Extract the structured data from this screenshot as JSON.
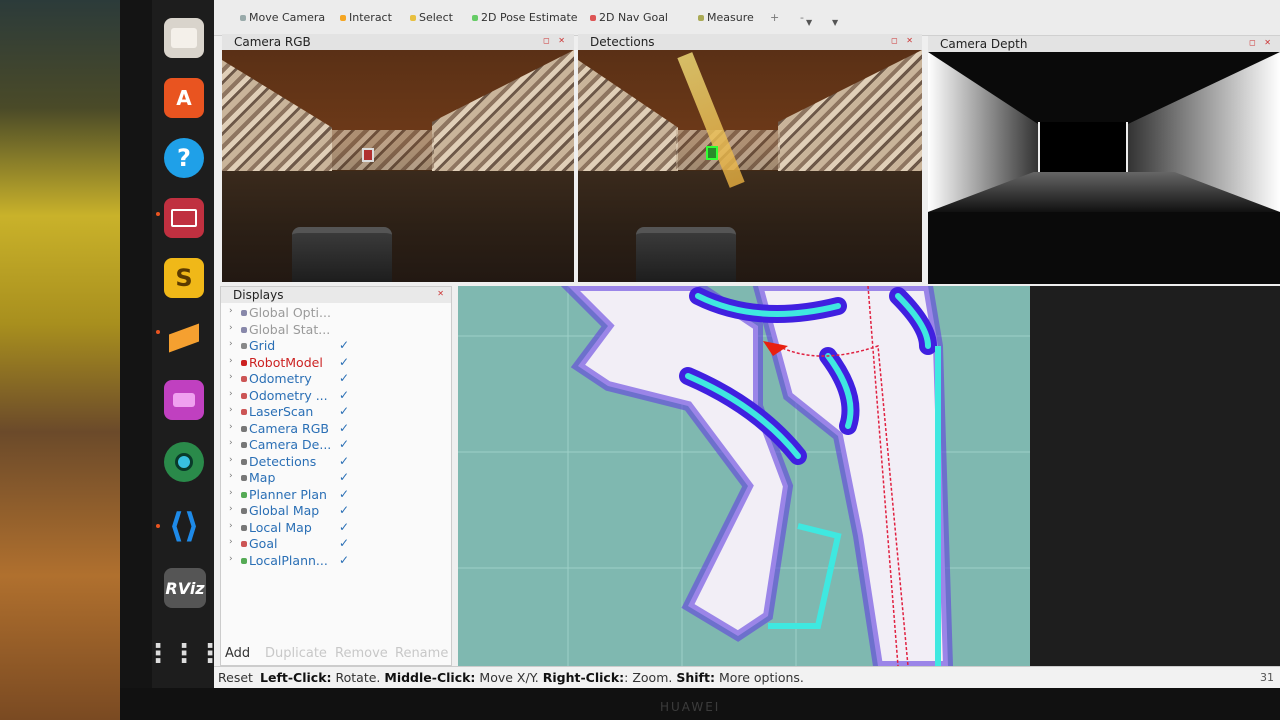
{
  "toolbar": {
    "tools": [
      {
        "label": "Move Camera",
        "color": "#9aa"
      },
      {
        "label": "Interact",
        "color": "#f5a623"
      },
      {
        "label": "Select",
        "color": "#e8c040"
      },
      {
        "label": "2D Pose Estimate",
        "color": "#6c6"
      },
      {
        "label": "2D Nav Goal",
        "color": "#d55"
      },
      {
        "label": "Measure",
        "color": "#aa5"
      }
    ]
  },
  "panels": {
    "camera_rgb": {
      "title": "Camera RGB"
    },
    "detections": {
      "title": "Detections"
    },
    "camera_depth": {
      "title": "Camera Depth"
    }
  },
  "displays": {
    "title": "Displays",
    "items": [
      {
        "label": "Global Opti...",
        "state": "dim",
        "icon": "globe-icon",
        "checked": false
      },
      {
        "label": "Global Stat...",
        "state": "dim",
        "icon": "globe-icon",
        "checked": false
      },
      {
        "label": "Grid",
        "state": "normal",
        "icon": "grid-icon",
        "checked": true
      },
      {
        "label": "RobotModel",
        "state": "error",
        "icon": "robot-icon",
        "checked": true
      },
      {
        "label": "Odometry",
        "state": "normal",
        "icon": "arrow-icon",
        "checked": true
      },
      {
        "label": "Odometry ...",
        "state": "normal",
        "icon": "arrow-icon",
        "checked": true
      },
      {
        "label": "LaserScan",
        "state": "normal",
        "icon": "laser-icon",
        "checked": true
      },
      {
        "label": "Camera RGB",
        "state": "normal",
        "icon": "camera-icon",
        "checked": true
      },
      {
        "label": "Camera De...",
        "state": "normal",
        "icon": "camera-icon",
        "checked": true
      },
      {
        "label": "Detections",
        "state": "normal",
        "icon": "image-icon",
        "checked": true
      },
      {
        "label": "Map",
        "state": "normal",
        "icon": "map-icon",
        "checked": true
      },
      {
        "label": "Planner Plan",
        "state": "normal",
        "icon": "path-icon",
        "checked": true
      },
      {
        "label": "Global Map",
        "state": "normal",
        "icon": "map-icon",
        "checked": true
      },
      {
        "label": "Local Map",
        "state": "normal",
        "icon": "map-icon",
        "checked": true
      },
      {
        "label": "Goal",
        "state": "normal",
        "icon": "pose-icon",
        "checked": true
      },
      {
        "label": "LocalPlann...",
        "state": "normal",
        "icon": "path-icon",
        "checked": true
      }
    ],
    "buttons": {
      "add": "Add",
      "duplicate": "Duplicate",
      "remove": "Remove",
      "rename": "Rename"
    }
  },
  "statusbar": {
    "reset": "Reset",
    "left_click": "Left-Click:",
    "left_click_action": "Rotate.",
    "middle_click": "Middle-Click:",
    "middle_click_action": "Move X/Y.",
    "right_click": "Right-Click:",
    "right_click_action": ": Zoom.",
    "shift": "Shift:",
    "shift_action": "More options.",
    "fps": "31"
  },
  "dock": {
    "rviz_label": "RViz"
  },
  "device": {
    "brand": "HUAWEI"
  },
  "colors": {
    "dock_bg": "#1d1d1d",
    "display_link": "#2a6fb5",
    "error_red": "#cc2222",
    "map_teal": "#7fb8b0",
    "costmap_purple": "#5a2fe0",
    "costmap_cyan": "#3fe8e0"
  }
}
